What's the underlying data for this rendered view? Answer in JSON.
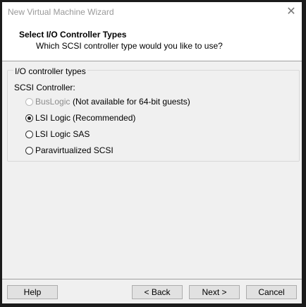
{
  "window": {
    "title": "New Virtual Machine Wizard",
    "close_icon": "close-icon"
  },
  "header": {
    "title": "Select I/O Controller Types",
    "subtitle": "Which SCSI controller type would you like to use?"
  },
  "group": {
    "legend": "I/O controller types",
    "label": "SCSI Controller:",
    "options": [
      {
        "label": "BusLogic",
        "note": "(Not available for 64-bit guests)",
        "selected": false,
        "disabled": true
      },
      {
        "label": "LSI Logic",
        "note": "(Recommended)",
        "selected": true,
        "disabled": false
      },
      {
        "label": "LSI Logic SAS",
        "note": "",
        "selected": false,
        "disabled": false
      },
      {
        "label": "Paravirtualized SCSI",
        "note": "",
        "selected": false,
        "disabled": false
      }
    ]
  },
  "buttons": {
    "help": "Help",
    "back": "< Back",
    "next": "Next >",
    "cancel": "Cancel"
  }
}
